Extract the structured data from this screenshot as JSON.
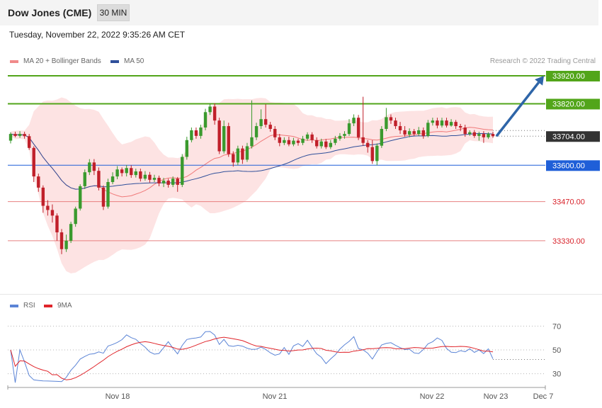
{
  "header": {
    "title": "Dow Jones (CME)",
    "timeframe": "30 MIN"
  },
  "datetime": "Tuesday, November 22, 2022 9:35:26 AM CET",
  "legend": {
    "ma20": "MA 20 + Bollinger Bands",
    "ma50": "MA 50",
    "rsi": "RSI",
    "ma9": "9MA"
  },
  "credit": "Research © 2022 Trading Central",
  "colors": {
    "up": "#3a9a2e",
    "down": "#c0202a",
    "band": "#fde3e3",
    "ma20": "#f07a7a",
    "ma50": "#2f4f9a",
    "resistance": "#52a51a",
    "pivot": "#1f5fd8",
    "support": "#e88080",
    "arrow": "#2e65a8",
    "rsi": "#5b84d6",
    "rsi_ma": "#e0242a"
  },
  "chart_data": {
    "type": "candlestick",
    "x_axis_labels": [
      "Nov 18",
      "Nov 21",
      "Nov 22",
      "Nov 23",
      "Dec 7"
    ],
    "y_axis": "price",
    "last_price": 33704,
    "levels": [
      {
        "label": "33920.00",
        "value": 33920,
        "kind": "resistance"
      },
      {
        "label": "33820.00",
        "value": 33820,
        "kind": "resistance"
      },
      {
        "label": "33704.00",
        "value": 33704,
        "kind": "last"
      },
      {
        "label": "33600.00",
        "value": 33600,
        "kind": "pivot"
      },
      {
        "label": "33470.00",
        "value": 33470,
        "kind": "support"
      },
      {
        "label": "33330.00",
        "value": 33330,
        "kind": "support"
      }
    ],
    "forecast_target": 33920,
    "candles": [
      [
        33688,
        33712,
        33678,
        33718
      ],
      [
        33712,
        33705,
        33700,
        33720
      ],
      [
        33705,
        33712,
        33698,
        33722
      ],
      [
        33712,
        33704,
        33695,
        33720
      ],
      [
        33704,
        33662,
        33655,
        33712
      ],
      [
        33662,
        33560,
        33540,
        33668
      ],
      [
        33560,
        33520,
        33505,
        33570
      ],
      [
        33520,
        33455,
        33430,
        33528
      ],
      [
        33455,
        33440,
        33420,
        33475
      ],
      [
        33440,
        33420,
        33395,
        33460
      ],
      [
        33420,
        33360,
        33330,
        33428
      ],
      [
        33360,
        33300,
        33282,
        33372
      ],
      [
        33300,
        33330,
        33290,
        33352
      ],
      [
        33330,
        33390,
        33322,
        33398
      ],
      [
        33390,
        33445,
        33380,
        33452
      ],
      [
        33445,
        33525,
        33438,
        33532
      ],
      [
        33525,
        33575,
        33515,
        33585
      ],
      [
        33575,
        33610,
        33565,
        33622
      ],
      [
        33610,
        33580,
        33565,
        33622
      ],
      [
        33580,
        33520,
        33510,
        33592
      ],
      [
        33520,
        33452,
        33440,
        33528
      ],
      [
        33452,
        33540,
        33445,
        33552
      ],
      [
        33540,
        33560,
        33532,
        33575
      ],
      [
        33560,
        33585,
        33550,
        33597
      ],
      [
        33585,
        33572,
        33560,
        33592
      ],
      [
        33572,
        33590,
        33560,
        33601
      ],
      [
        33590,
        33565,
        33555,
        33600
      ],
      [
        33565,
        33578,
        33556,
        33588
      ],
      [
        33578,
        33552,
        33542,
        33588
      ],
      [
        33552,
        33566,
        33545,
        33579
      ],
      [
        33566,
        33548,
        33538,
        33576
      ],
      [
        33548,
        33555,
        33540,
        33566
      ],
      [
        33555,
        33535,
        33525,
        33563
      ],
      [
        33535,
        33545,
        33522,
        33555
      ],
      [
        33545,
        33530,
        33520,
        33552
      ],
      [
        33530,
        33552,
        33522,
        33560
      ],
      [
        33552,
        33530,
        33505,
        33558
      ],
      [
        33530,
        33630,
        33522,
        33640
      ],
      [
        33630,
        33690,
        33620,
        33702
      ],
      [
        33690,
        33725,
        33682,
        33735
      ],
      [
        33725,
        33705,
        33695,
        33735
      ],
      [
        33705,
        33735,
        33695,
        33745
      ],
      [
        33735,
        33790,
        33725,
        33802
      ],
      [
        33790,
        33810,
        33780,
        33822
      ],
      [
        33810,
        33760,
        33745,
        33822
      ],
      [
        33760,
        33650,
        33640,
        33770
      ],
      [
        33650,
        33740,
        33642,
        33760
      ],
      [
        33740,
        33640,
        33630,
        33752
      ],
      [
        33640,
        33610,
        33595,
        33650
      ],
      [
        33610,
        33660,
        33600,
        33670
      ],
      [
        33660,
        33620,
        33605,
        33670
      ],
      [
        33620,
        33668,
        33612,
        33680
      ],
      [
        33668,
        33700,
        33660,
        33832
      ],
      [
        33700,
        33740,
        33690,
        33752
      ],
      [
        33740,
        33765,
        33730,
        33800
      ],
      [
        33765,
        33745,
        33735,
        33818
      ],
      [
        33745,
        33730,
        33720,
        33755
      ],
      [
        33730,
        33700,
        33690,
        33740
      ],
      [
        33700,
        33680,
        33668,
        33712
      ],
      [
        33680,
        33690,
        33672,
        33700
      ],
      [
        33690,
        33675,
        33668,
        33702
      ],
      [
        33675,
        33688,
        33668,
        33698
      ],
      [
        33688,
        33680,
        33670,
        33695
      ],
      [
        33680,
        33695,
        33672,
        33705
      ],
      [
        33695,
        33710,
        33688,
        33718
      ],
      [
        33710,
        33690,
        33680,
        33718
      ],
      [
        33690,
        33668,
        33660,
        33700
      ],
      [
        33668,
        33685,
        33660,
        33695
      ],
      [
        33685,
        33665,
        33658,
        33694
      ],
      [
        33665,
        33680,
        33658,
        33690
      ],
      [
        33680,
        33695,
        33672,
        33705
      ],
      [
        33695,
        33705,
        33688,
        33715
      ],
      [
        33705,
        33712,
        33695,
        33722
      ],
      [
        33712,
        33750,
        33705,
        33765
      ],
      [
        33750,
        33770,
        33740,
        33782
      ],
      [
        33770,
        33700,
        33690,
        33780
      ],
      [
        33700,
        33680,
        33670,
        33845
      ],
      [
        33680,
        33665,
        33645,
        33690
      ],
      [
        33665,
        33615,
        33605,
        33690
      ],
      [
        33615,
        33670,
        33600,
        33678
      ],
      [
        33670,
        33730,
        33662,
        33740
      ],
      [
        33730,
        33772,
        33722,
        33805
      ],
      [
        33772,
        33760,
        33748,
        33782
      ],
      [
        33760,
        33740,
        33730,
        33770
      ],
      [
        33740,
        33725,
        33712,
        33755
      ],
      [
        33725,
        33710,
        33702,
        33740
      ],
      [
        33710,
        33722,
        33700,
        33732
      ],
      [
        33722,
        33712,
        33705,
        33730
      ],
      [
        33712,
        33725,
        33705,
        33737
      ],
      [
        33725,
        33705,
        33695,
        33735
      ],
      [
        33705,
        33752,
        33700,
        33762
      ],
      [
        33752,
        33760,
        33742,
        33770
      ],
      [
        33760,
        33742,
        33732,
        33770
      ],
      [
        33742,
        33760,
        33735,
        33770
      ],
      [
        33760,
        33742,
        33735,
        33770
      ],
      [
        33742,
        33755,
        33738,
        33765
      ],
      [
        33755,
        33740,
        33730,
        33762
      ],
      [
        33740,
        33735,
        33722,
        33748
      ],
      [
        33735,
        33712,
        33702,
        33745
      ],
      [
        33712,
        33718,
        33705,
        33725
      ],
      [
        33718,
        33705,
        33698,
        33726
      ],
      [
        33705,
        33712,
        33688,
        33720
      ],
      [
        33712,
        33700,
        33680,
        33722
      ],
      [
        33700,
        33712,
        33694,
        33718
      ],
      [
        33712,
        33704,
        33698,
        33720
      ]
    ],
    "rsi": {
      "label": "RSI",
      "ma_label": "9MA",
      "ticks": [
        70,
        50,
        30
      ],
      "range": [
        20,
        80
      ],
      "last": 42
    }
  }
}
